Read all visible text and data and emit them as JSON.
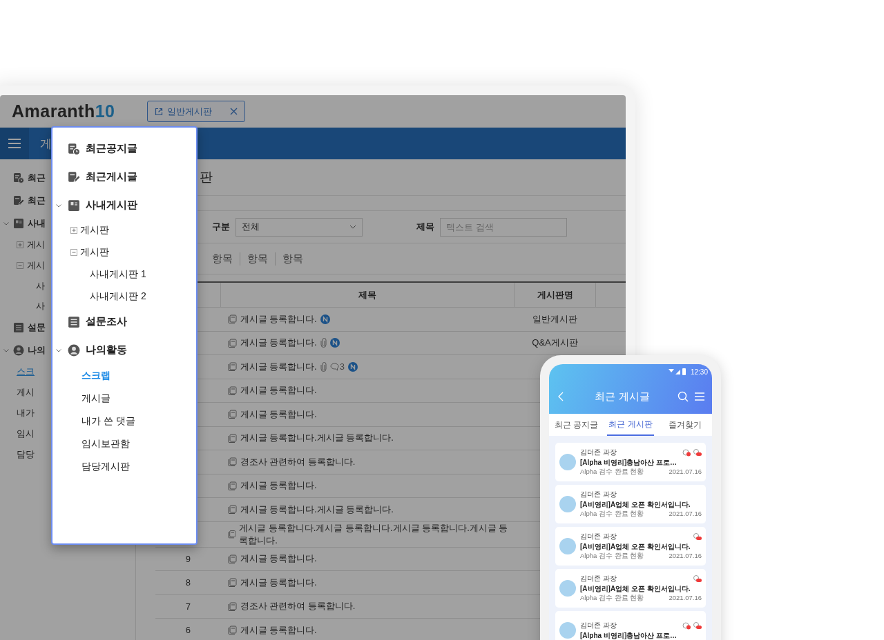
{
  "tablet": {
    "logo": {
      "word": "Amaranth",
      "number": "10"
    },
    "open_tab": {
      "label": "일반게시판"
    },
    "nav_title": "게",
    "sidebar": {
      "items": [
        {
          "label": "최근",
          "kind": "notice",
          "selected": false
        },
        {
          "label": "최근",
          "kind": "post",
          "selected": false
        },
        {
          "label": "사내",
          "kind": "board",
          "expanded": true,
          "selected": false,
          "children": [
            {
              "label": "게시",
              "expanded": false,
              "selected": false
            },
            {
              "label": "게시",
              "expanded": true,
              "selected": false,
              "children": [
                {
                  "label": "사",
                  "selected": false
                },
                {
                  "label": "사",
                  "selected": false
                }
              ]
            }
          ]
        },
        {
          "label": "설문",
          "kind": "survey",
          "selected": false
        },
        {
          "label": "나의",
          "kind": "user",
          "expanded": true,
          "selected": false,
          "children": [
            {
              "label": "스크",
              "selected": true
            },
            {
              "label": "게시",
              "selected": false
            },
            {
              "label": "내가",
              "selected": false
            },
            {
              "label": "임시",
              "selected": false
            },
            {
              "label": "담당",
              "selected": false
            }
          ]
        }
      ]
    },
    "board_title": "판",
    "filters": [
      {
        "kind": "select",
        "label": "구분",
        "value": "전체"
      },
      {
        "kind": "text",
        "label": "제목",
        "placeholder": "텍스트 검색"
      }
    ],
    "tabs": [
      "항목",
      "항목",
      "항목"
    ],
    "table": {
      "columns": [
        "제목",
        "게시판명"
      ],
      "rows": [
        {
          "title": "게시글 등록합니다.",
          "attachment": false,
          "new": true,
          "board": "일반게시판"
        },
        {
          "title": "게시글 등록합니다.",
          "attachment": true,
          "new": true,
          "board": "Q&A게시판"
        },
        {
          "title": "게시글 등록합니다.",
          "attachment": true,
          "comments": "3",
          "new": true
        },
        {
          "title": "게시글 등록합니다.",
          "attachment": false,
          "new": false
        },
        {
          "title": "게시글 등록합니다.",
          "attachment": false,
          "new": false
        },
        {
          "title": "게시글 등록합니다.게시글 등록합니다.",
          "attachment": false,
          "new": false
        },
        {
          "title": "경조사 관련하여 등록합니다.",
          "attachment": false,
          "new": false
        },
        {
          "title": "게시글 등록합니다.",
          "attachment": false,
          "new": false
        },
        {
          "title": "게시글 등록합니다.게시글 등록합니다.",
          "attachment": false,
          "new": false
        },
        {
          "title": "게시글 등록합니다.게시글 등록합니다.게시글 등록합니다.게시글 등록합니다.",
          "attachment": false,
          "new": false
        },
        {
          "number": "9",
          "title": "게시글 등록합니다.",
          "attachment": false,
          "new": false
        },
        {
          "number": "8",
          "title": "게시글 등록합니다.",
          "attachment": false,
          "new": false
        },
        {
          "number": "7",
          "title": "경조사 관련하여 등록합니다.",
          "attachment": false,
          "new": false
        },
        {
          "number": "6",
          "title": "게시글 등록합니다.",
          "attachment": false,
          "new": false
        }
      ]
    },
    "menu": {
      "items": [
        {
          "label": "최근공지글",
          "kind": "notice",
          "selected": false
        },
        {
          "label": "최근게시글",
          "kind": "post",
          "selected": false
        },
        {
          "label": "사내게시판",
          "kind": "board",
          "expanded": true,
          "selected": false,
          "children": [
            {
              "label": "게시판",
              "expanded": false,
              "selected": false
            },
            {
              "label": "게시판",
              "expanded": true,
              "selected": false,
              "children": [
                {
                  "label": "사내게시판 1",
                  "selected": false
                },
                {
                  "label": "사내게시판 2",
                  "selected": false
                }
              ]
            }
          ]
        },
        {
          "label": "설문조사",
          "kind": "survey",
          "selected": false
        },
        {
          "label": "나의활동",
          "kind": "user",
          "expanded": true,
          "selected": false,
          "children": [
            {
              "label": "스크랩",
              "selected": true
            },
            {
              "label": "게시글",
              "selected": false
            },
            {
              "label": "내가 쓴 댓글",
              "selected": false
            },
            {
              "label": "임시보관함",
              "selected": false
            },
            {
              "label": "담당게시판",
              "selected": false
            }
          ]
        }
      ]
    }
  },
  "phone": {
    "time": "12:30",
    "title": "최근 게시글",
    "tabs": [
      {
        "label": "최근 공지글",
        "selected": false
      },
      {
        "label": "최근 게시판",
        "selected": true
      },
      {
        "label": "즐겨찾기",
        "selected": false
      }
    ],
    "posts": [
      {
        "author": "김더존 과장",
        "title": "[Alpha 비영리]충남아산 프로…",
        "subtitle": "Alpha 검수 완료 현황",
        "date": "2021.07.16",
        "comment": true,
        "attachment": true
      },
      {
        "author": "김더존 과장",
        "title": "[A비영리]A업체 오픈 확인서입니다.",
        "subtitle": "Alpha 검수 완료 현황",
        "date": "2021.07.16",
        "comment": false,
        "attachment": false
      },
      {
        "author": "김더존 과장",
        "title": "[A비영리]A업체 오픈 확인서입니다.",
        "subtitle": "Alpha 검수 완료 현황",
        "date": "2021.07.16",
        "comment": false,
        "attachment": true
      },
      {
        "author": "김더존 과장",
        "title": "[A비영리]A업체 오픈 확인서입니다.",
        "subtitle": "Alpha 검수 완료 현황",
        "date": "2021.07.16",
        "comment": false,
        "attachment": true
      },
      {
        "author": "김더존 과장",
        "title": "[Alpha 비영리]충남아산 프로…",
        "comment": true,
        "attachment": true
      }
    ]
  }
}
